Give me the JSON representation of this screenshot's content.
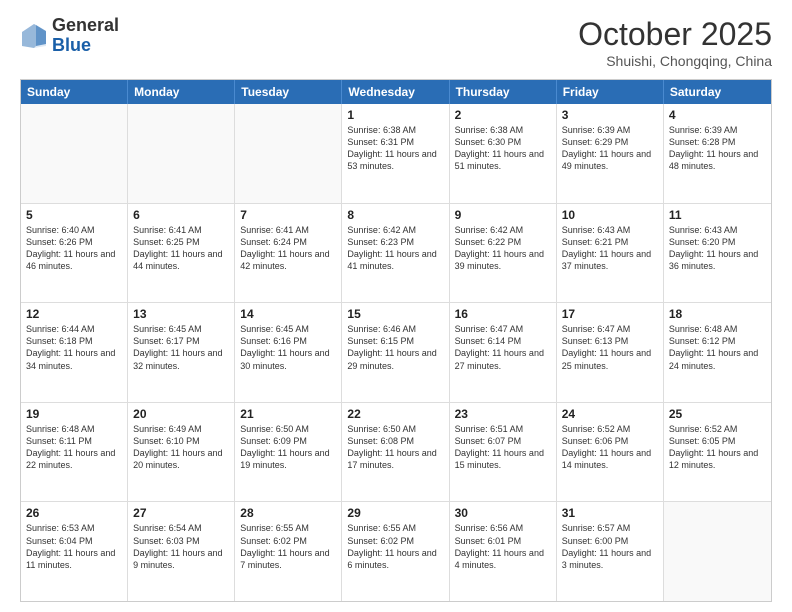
{
  "header": {
    "logo_general": "General",
    "logo_blue": "Blue",
    "month": "October 2025",
    "location": "Shuishi, Chongqing, China"
  },
  "days_of_week": [
    "Sunday",
    "Monday",
    "Tuesday",
    "Wednesday",
    "Thursday",
    "Friday",
    "Saturday"
  ],
  "weeks": [
    [
      {
        "day": "",
        "empty": true
      },
      {
        "day": "",
        "empty": true
      },
      {
        "day": "",
        "empty": true
      },
      {
        "day": "1",
        "sunrise": "6:38 AM",
        "sunset": "6:31 PM",
        "daylight": "11 hours and 53 minutes."
      },
      {
        "day": "2",
        "sunrise": "6:38 AM",
        "sunset": "6:30 PM",
        "daylight": "11 hours and 51 minutes."
      },
      {
        "day": "3",
        "sunrise": "6:39 AM",
        "sunset": "6:29 PM",
        "daylight": "11 hours and 49 minutes."
      },
      {
        "day": "4",
        "sunrise": "6:39 AM",
        "sunset": "6:28 PM",
        "daylight": "11 hours and 48 minutes."
      }
    ],
    [
      {
        "day": "5",
        "sunrise": "6:40 AM",
        "sunset": "6:26 PM",
        "daylight": "11 hours and 46 minutes."
      },
      {
        "day": "6",
        "sunrise": "6:41 AM",
        "sunset": "6:25 PM",
        "daylight": "11 hours and 44 minutes."
      },
      {
        "day": "7",
        "sunrise": "6:41 AM",
        "sunset": "6:24 PM",
        "daylight": "11 hours and 42 minutes."
      },
      {
        "day": "8",
        "sunrise": "6:42 AM",
        "sunset": "6:23 PM",
        "daylight": "11 hours and 41 minutes."
      },
      {
        "day": "9",
        "sunrise": "6:42 AM",
        "sunset": "6:22 PM",
        "daylight": "11 hours and 39 minutes."
      },
      {
        "day": "10",
        "sunrise": "6:43 AM",
        "sunset": "6:21 PM",
        "daylight": "11 hours and 37 minutes."
      },
      {
        "day": "11",
        "sunrise": "6:43 AM",
        "sunset": "6:20 PM",
        "daylight": "11 hours and 36 minutes."
      }
    ],
    [
      {
        "day": "12",
        "sunrise": "6:44 AM",
        "sunset": "6:18 PM",
        "daylight": "11 hours and 34 minutes."
      },
      {
        "day": "13",
        "sunrise": "6:45 AM",
        "sunset": "6:17 PM",
        "daylight": "11 hours and 32 minutes."
      },
      {
        "day": "14",
        "sunrise": "6:45 AM",
        "sunset": "6:16 PM",
        "daylight": "11 hours and 30 minutes."
      },
      {
        "day": "15",
        "sunrise": "6:46 AM",
        "sunset": "6:15 PM",
        "daylight": "11 hours and 29 minutes."
      },
      {
        "day": "16",
        "sunrise": "6:47 AM",
        "sunset": "6:14 PM",
        "daylight": "11 hours and 27 minutes."
      },
      {
        "day": "17",
        "sunrise": "6:47 AM",
        "sunset": "6:13 PM",
        "daylight": "11 hours and 25 minutes."
      },
      {
        "day": "18",
        "sunrise": "6:48 AM",
        "sunset": "6:12 PM",
        "daylight": "11 hours and 24 minutes."
      }
    ],
    [
      {
        "day": "19",
        "sunrise": "6:48 AM",
        "sunset": "6:11 PM",
        "daylight": "11 hours and 22 minutes."
      },
      {
        "day": "20",
        "sunrise": "6:49 AM",
        "sunset": "6:10 PM",
        "daylight": "11 hours and 20 minutes."
      },
      {
        "day": "21",
        "sunrise": "6:50 AM",
        "sunset": "6:09 PM",
        "daylight": "11 hours and 19 minutes."
      },
      {
        "day": "22",
        "sunrise": "6:50 AM",
        "sunset": "6:08 PM",
        "daylight": "11 hours and 17 minutes."
      },
      {
        "day": "23",
        "sunrise": "6:51 AM",
        "sunset": "6:07 PM",
        "daylight": "11 hours and 15 minutes."
      },
      {
        "day": "24",
        "sunrise": "6:52 AM",
        "sunset": "6:06 PM",
        "daylight": "11 hours and 14 minutes."
      },
      {
        "day": "25",
        "sunrise": "6:52 AM",
        "sunset": "6:05 PM",
        "daylight": "11 hours and 12 minutes."
      }
    ],
    [
      {
        "day": "26",
        "sunrise": "6:53 AM",
        "sunset": "6:04 PM",
        "daylight": "11 hours and 11 minutes."
      },
      {
        "day": "27",
        "sunrise": "6:54 AM",
        "sunset": "6:03 PM",
        "daylight": "11 hours and 9 minutes."
      },
      {
        "day": "28",
        "sunrise": "6:55 AM",
        "sunset": "6:02 PM",
        "daylight": "11 hours and 7 minutes."
      },
      {
        "day": "29",
        "sunrise": "6:55 AM",
        "sunset": "6:02 PM",
        "daylight": "11 hours and 6 minutes."
      },
      {
        "day": "30",
        "sunrise": "6:56 AM",
        "sunset": "6:01 PM",
        "daylight": "11 hours and 4 minutes."
      },
      {
        "day": "31",
        "sunrise": "6:57 AM",
        "sunset": "6:00 PM",
        "daylight": "11 hours and 3 minutes."
      },
      {
        "day": "",
        "empty": true
      }
    ]
  ],
  "labels": {
    "sunrise_prefix": "Sunrise: ",
    "sunset_prefix": "Sunset: ",
    "daylight_prefix": "Daylight: "
  }
}
